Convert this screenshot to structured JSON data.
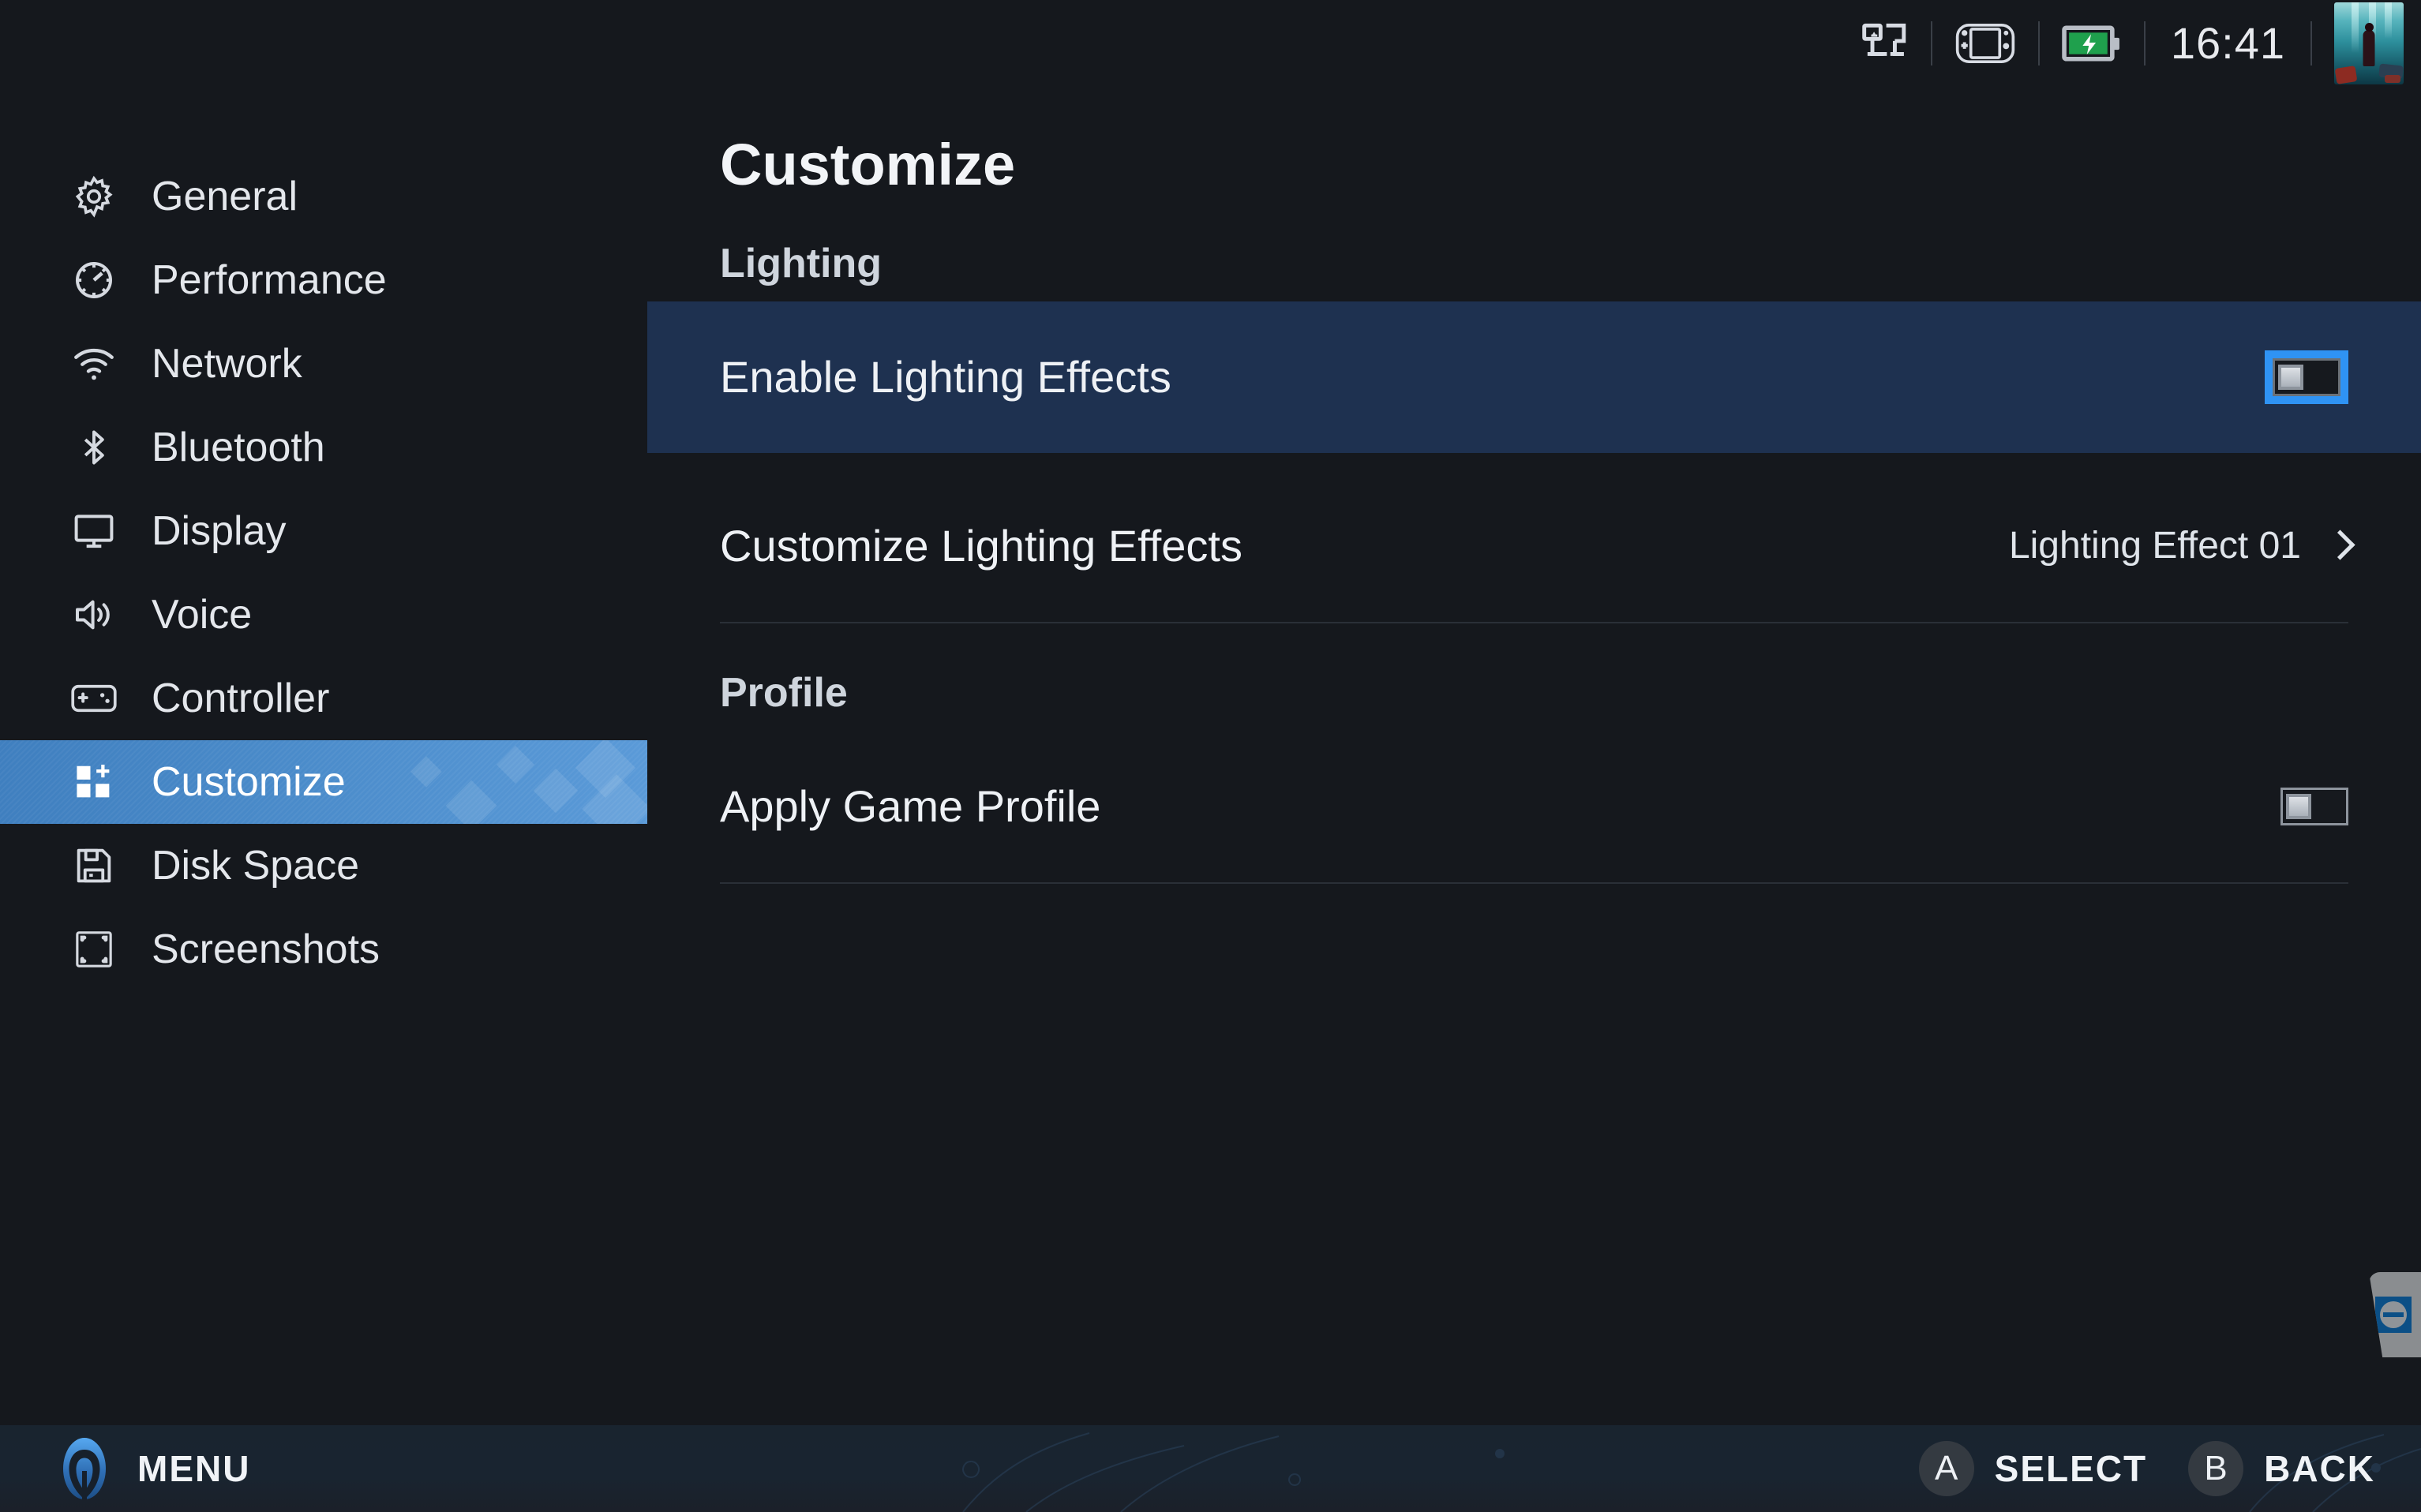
{
  "statusbar": {
    "icons": [
      "network-ethernet-icon",
      "handheld-device-icon",
      "battery-charging-icon"
    ],
    "clock": "16:41",
    "thumbnail_name": "game-thumbnail"
  },
  "sidebar": {
    "items": [
      {
        "label": "General",
        "icon": "gear-icon",
        "selected": false
      },
      {
        "label": "Performance",
        "icon": "gauge-icon",
        "selected": false
      },
      {
        "label": "Network",
        "icon": "wifi-icon",
        "selected": false
      },
      {
        "label": "Bluetooth",
        "icon": "bluetooth-icon",
        "selected": false
      },
      {
        "label": "Display",
        "icon": "monitor-icon",
        "selected": false
      },
      {
        "label": "Voice",
        "icon": "speaker-icon",
        "selected": false
      },
      {
        "label": "Controller",
        "icon": "gamepad-icon",
        "selected": false
      },
      {
        "label": "Customize",
        "icon": "customize-icon",
        "selected": true
      },
      {
        "label": "Disk Space",
        "icon": "floppy-disk-icon",
        "selected": false
      },
      {
        "label": "Screenshots",
        "icon": "screenshot-icon",
        "selected": false
      }
    ]
  },
  "main": {
    "title": "Customize",
    "sections": [
      {
        "heading": "Lighting",
        "rows": [
          {
            "label": "Enable Lighting Effects",
            "control": "toggle",
            "value": "off",
            "focused": true
          },
          {
            "label": "Customize Lighting Effects",
            "control": "chevron",
            "value": "Lighting Effect 01",
            "focused": false
          }
        ]
      },
      {
        "heading": "Profile",
        "rows": [
          {
            "label": "Apply Game Profile",
            "control": "toggle",
            "value": "off",
            "focused": false
          }
        ]
      }
    ]
  },
  "edge_tab": {
    "icon": "teamviewer-arrows-icon"
  },
  "bottombar": {
    "menu_label": "MENU",
    "logo_name": "legion-logo",
    "hints": [
      {
        "button": "A",
        "label": "SELECT"
      },
      {
        "button": "B",
        "label": "BACK"
      }
    ]
  },
  "colors": {
    "background": "#15181d",
    "accent_blue": "#4a8bca",
    "focus_blue": "#2f93f4",
    "row_focus_bg": "#1e3150",
    "battery_green": "#22a04a",
    "bottombar_bg": "#19242f"
  }
}
